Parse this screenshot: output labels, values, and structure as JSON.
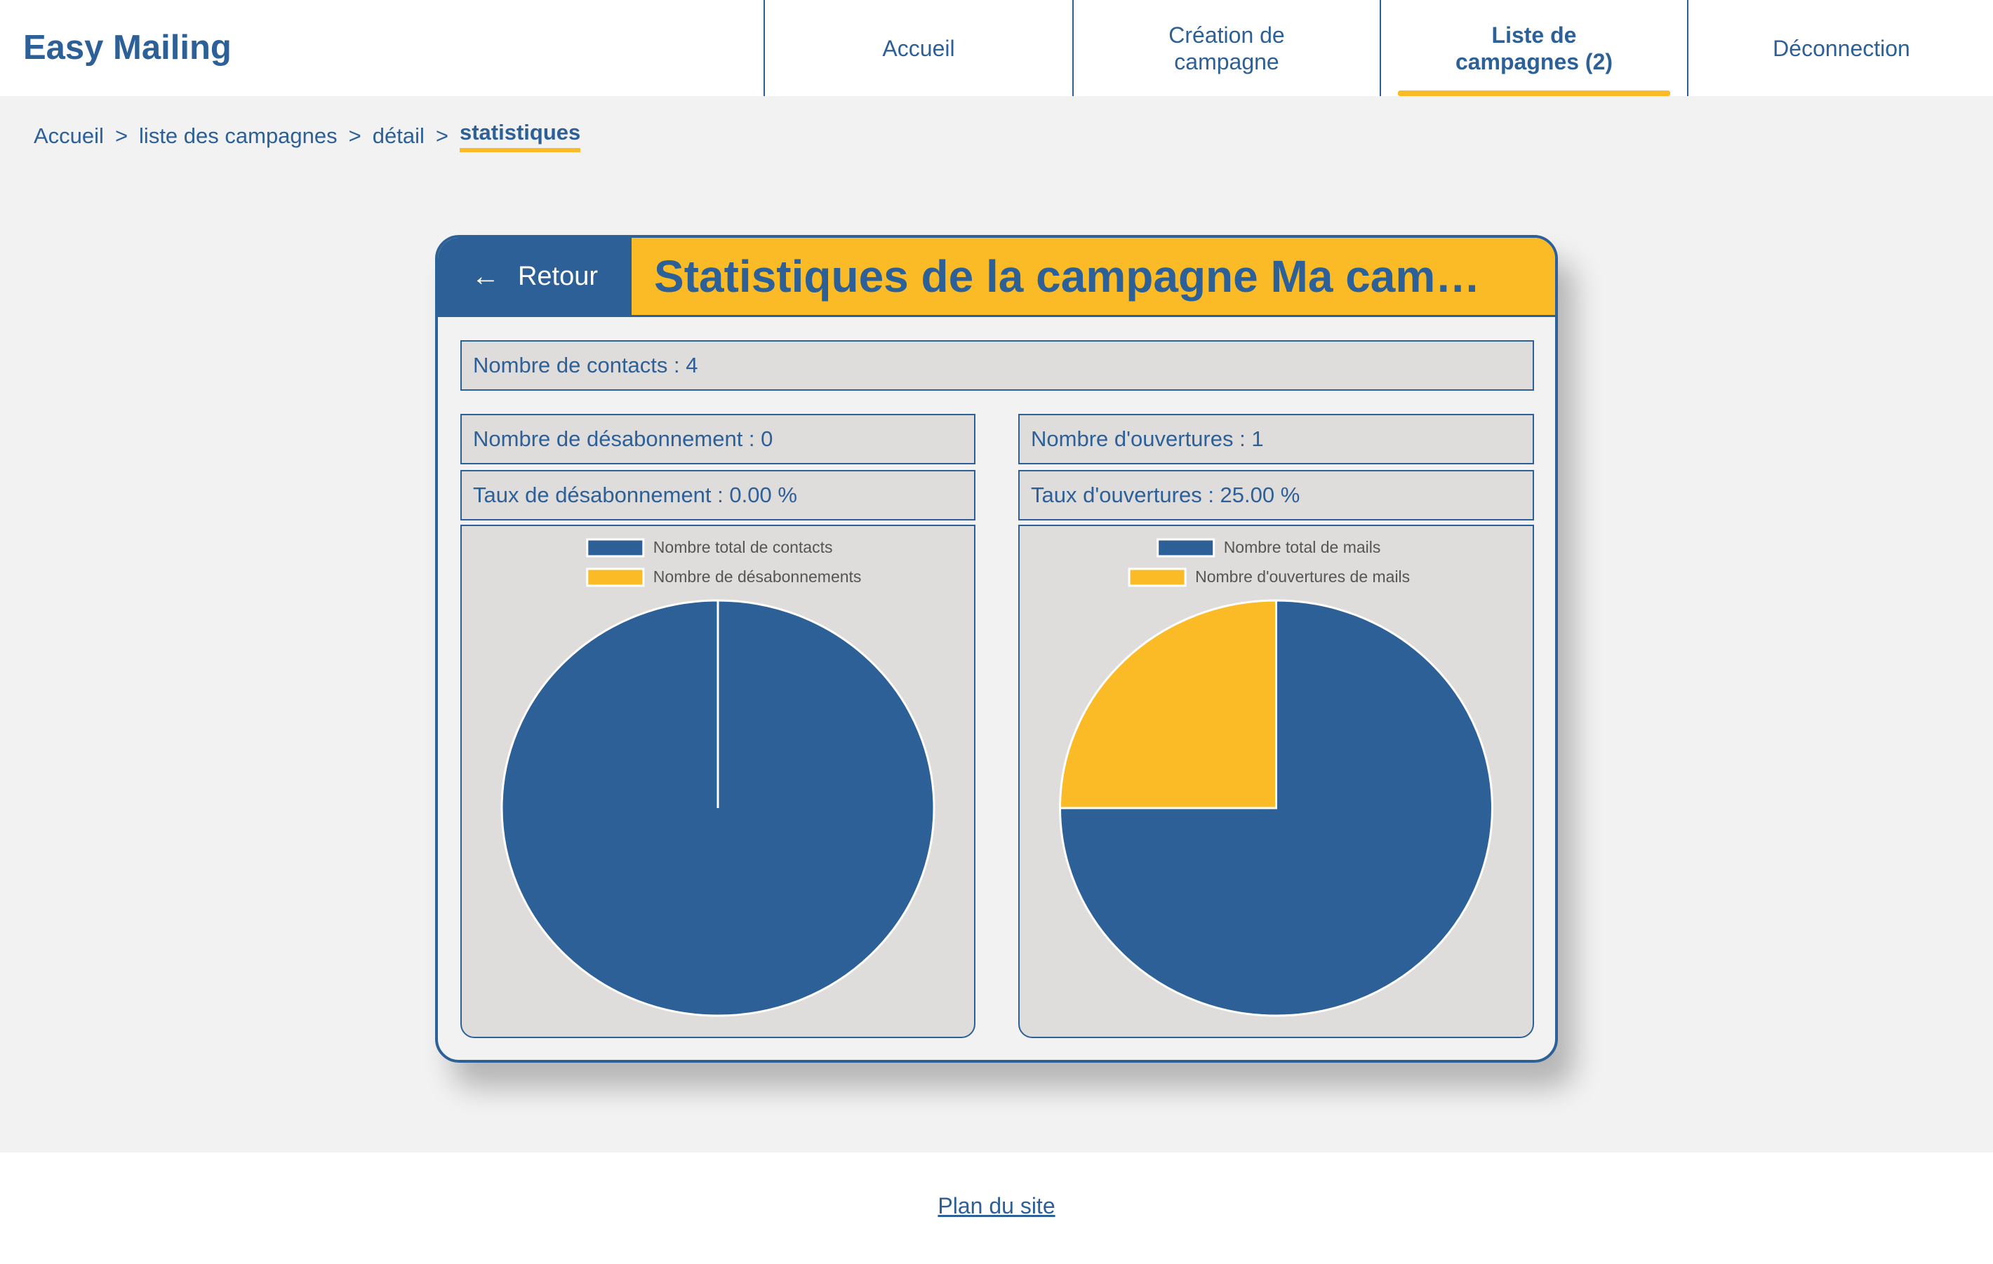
{
  "app": {
    "title": "Easy Mailing"
  },
  "nav": [
    {
      "label": "Accueil",
      "active": false
    },
    {
      "label": "Création de campagne",
      "active": false
    },
    {
      "label": "Liste de campagnes (2)",
      "active": true
    },
    {
      "label": "Déconnection",
      "active": false
    }
  ],
  "breadcrumb": {
    "items": [
      "Accueil",
      "liste des campagnes",
      "détail"
    ],
    "current": "statistiques",
    "separator": ">"
  },
  "card": {
    "back_label": "Retour",
    "back_icon": "left-arrow-icon",
    "title": "Statistiques de la campagne Ma cam…"
  },
  "stats": {
    "contacts": "Nombre de contacts : 4",
    "unsubscribes": "Nombre de désabonnement : 0",
    "unsubscribe_rate": "Taux de désabonnement : 0.00 %",
    "opens": "Nombre d'ouvertures : 1",
    "open_rate": "Taux d'ouvertures : 25.00 %"
  },
  "colors": {
    "primary": "#2c6096",
    "accent": "#fbbb27",
    "panel": "#dfdcdc"
  },
  "chart_data": [
    {
      "type": "pie",
      "labels": [
        "Nombre total de contacts",
        "Nombre de désabonnements"
      ],
      "values": [
        4,
        0
      ],
      "colors": [
        "#2c6096",
        "#fbbb27"
      ],
      "legend": "top"
    },
    {
      "type": "pie",
      "labels": [
        "Nombre total de mails",
        "Nombre d'ouvertures de mails"
      ],
      "values": [
        3,
        1
      ],
      "colors": [
        "#2c6096",
        "#fbbb27"
      ],
      "legend": "top"
    }
  ],
  "footer": {
    "link": "Plan du site"
  }
}
